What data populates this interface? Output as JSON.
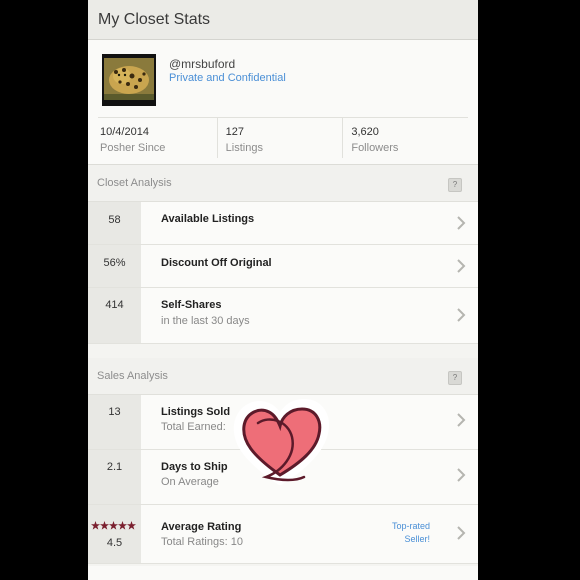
{
  "header": {
    "title": "My Closet Stats"
  },
  "profile": {
    "username": "@mrsbuford",
    "privacy": "Private and Confidential",
    "stats": [
      {
        "value": "10/4/2014",
        "label": "Posher Since"
      },
      {
        "value": "127",
        "label": "Listings"
      },
      {
        "value": "3,620",
        "label": "Followers"
      }
    ]
  },
  "closet_analysis": {
    "title": "Closet Analysis",
    "help": "?",
    "rows": [
      {
        "value": "58",
        "label": "Available Listings"
      },
      {
        "value": "56%",
        "label": "Discount Off Original"
      },
      {
        "value": "414",
        "label": "Self-Shares",
        "sublabel": "in the last 30 days"
      }
    ]
  },
  "sales_analysis": {
    "title": "Sales Analysis",
    "help": "?",
    "rows": [
      {
        "value": "13",
        "label": "Listings Sold",
        "sublabel": "Total Earned:"
      },
      {
        "value": "2.1",
        "label": "Days to Ship",
        "sublabel": "On Average"
      },
      {
        "value": "4.5",
        "label": "Average Rating",
        "sublabel": "Total Ratings: 10",
        "badge_line1": "Top-rated",
        "badge_line2": "Seller!",
        "stars": 5
      }
    ]
  },
  "colors": {
    "accent": "#4a8fd6",
    "heart": "#ee6e78",
    "heart_outline": "#5c1a2a"
  }
}
